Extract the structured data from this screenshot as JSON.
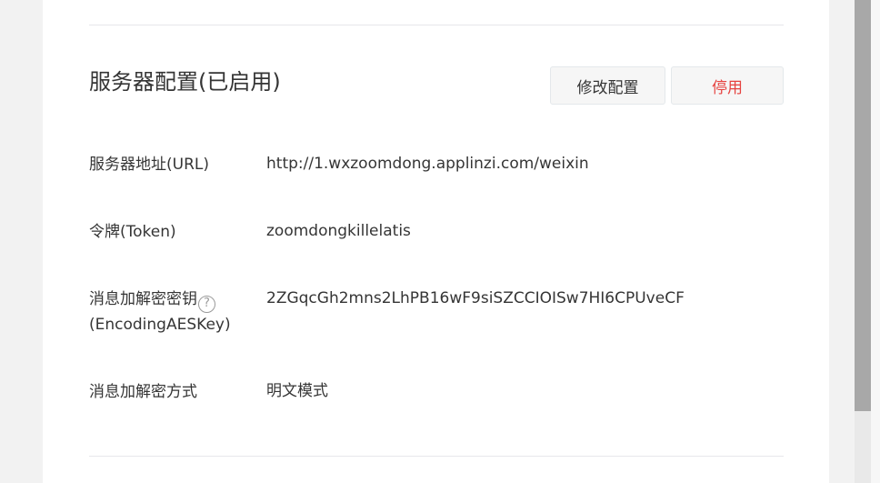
{
  "section": {
    "title": "服务器配置(已启用)",
    "modify_label": "修改配置",
    "disable_label": "停用"
  },
  "rows": [
    {
      "label": "服务器地址(URL)",
      "value": "http://1.wxzoomdong.applinzi.com/weixin"
    },
    {
      "label": "令牌(Token)",
      "value": "zoomdongkillelatis"
    },
    {
      "label_line1": "消息加解密密钥",
      "help_glyph": "?",
      "label_line2": "(EncodingAESKey)",
      "value": "2ZGqcGh2mns2LhPB16wF9siSZCCIOISw7HI6CPUveCF"
    },
    {
      "label": "消息加解密方式",
      "value": "明文模式"
    }
  ],
  "colors": {
    "danger": "#e64340",
    "text": "#353535",
    "divider": "#e7e7eb"
  },
  "icons": {
    "help": "help-icon"
  }
}
